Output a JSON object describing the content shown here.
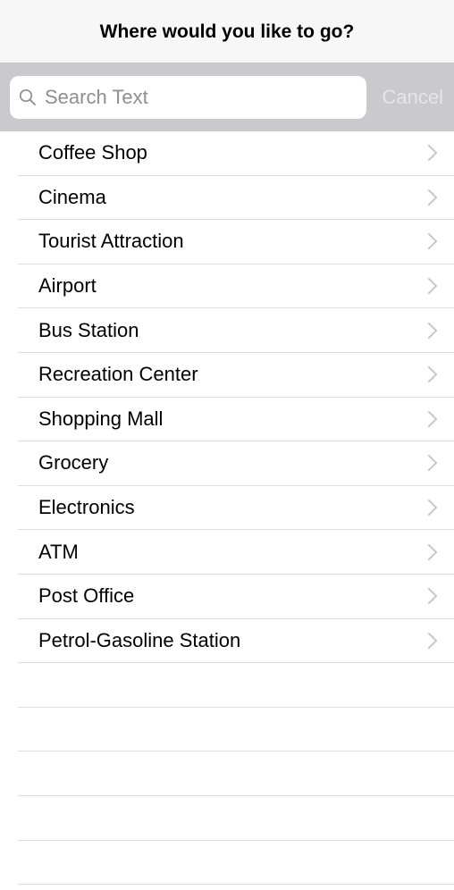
{
  "navbar": {
    "title": "Where would you like to go?"
  },
  "search": {
    "placeholder": "Search Text",
    "value": "",
    "cancel_label": "Cancel"
  },
  "list": {
    "items": [
      {
        "label": "Coffee Shop"
      },
      {
        "label": "Cinema"
      },
      {
        "label": "Tourist Attraction"
      },
      {
        "label": "Airport"
      },
      {
        "label": "Bus Station"
      },
      {
        "label": "Recreation Center"
      },
      {
        "label": "Shopping Mall"
      },
      {
        "label": "Grocery"
      },
      {
        "label": "Electronics"
      },
      {
        "label": "ATM"
      },
      {
        "label": "Post Office"
      },
      {
        "label": "Petrol-Gasoline Station"
      }
    ],
    "disclosure_icon": "chevron-right-icon"
  },
  "colors": {
    "navbar_bg": "#f7f7f7",
    "searchbar_bg": "#c9c9ce",
    "separator": "#dcdcdf",
    "chevron": "#c7c7cc",
    "placeholder": "#8e8e93",
    "cancel_text": "#e6e6e9"
  }
}
